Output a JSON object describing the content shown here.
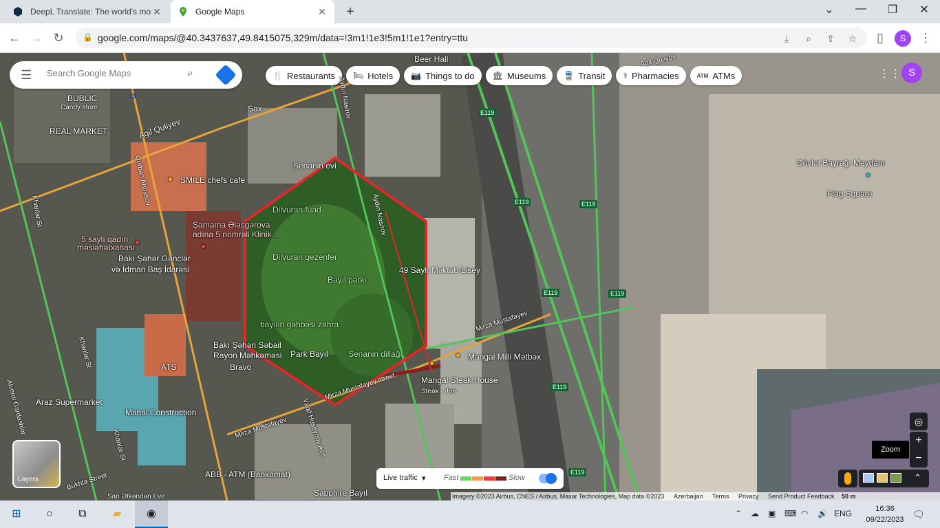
{
  "browser": {
    "tabs": [
      {
        "title": "DeepL Translate: The world's most",
        "active": false
      },
      {
        "title": "Google Maps",
        "active": true
      }
    ],
    "url": "google.com/maps/@40.3437637,49.8415075,329m/data=!3m1!1e3!5m1!1e1?entry=ttu",
    "profile_initial": "S"
  },
  "maps": {
    "search_placeholder": "Search Google Maps",
    "chips": [
      {
        "icon": "restaurant-icon",
        "glyph": "🍴",
        "label": "Restaurants"
      },
      {
        "icon": "hotel-icon",
        "glyph": "🛏",
        "label": "Hotels"
      },
      {
        "icon": "camera-icon",
        "glyph": "📷",
        "label": "Things to do"
      },
      {
        "icon": "museum-icon",
        "glyph": "🏛",
        "label": "Museums"
      },
      {
        "icon": "transit-icon",
        "glyph": "🚆",
        "label": "Transit"
      },
      {
        "icon": "pharmacy-icon",
        "glyph": "⚕",
        "label": "Pharmacies"
      },
      {
        "icon": "atm-icon",
        "glyph": "ATM",
        "label": "ATMs"
      }
    ],
    "profile_initial": "S",
    "place_labels": {
      "bublic": "BUBLIC",
      "candy_store": "Candy store",
      "real_market": "REAL MARKET",
      "agil_quliyev": "Agil Quliyev",
      "sax": "Şax",
      "smile_cafe": "SMILE chefs cafe",
      "shamama": "Şamama Ələsgərova",
      "adina": "adına 5 nömrəli Klinik...",
      "qadin": "5 saylı qadın",
      "maslahatxanasi": "məsləhətxanası",
      "baki_saher": "Bakı Şəhər Gənclər",
      "idman": "və İdman Baş İdarəsi",
      "senanin_evi": "Senanin evi",
      "dilvuran_fuad": "Dilvuran fuad",
      "dilvuran_qezenfer": "Dilvuran qezenfer",
      "bayil_parki": "Bayıl parkı",
      "bayilin_gehbesi": "bayılın gəhbəsi zəhra",
      "park_bayil": "Park Bayıl",
      "senanin_dillagi": "Senanin dillağı",
      "mekteb": "49 Saylı Məktəb-Lisey",
      "mangal_milli": "Mangal Milli Mətbəx",
      "mangal_steak": "Mangal Steak House",
      "steak": "Steak · ₼₼",
      "sebail_1": "Bakı Şəhəri Səbail",
      "sebail_2": "Rayon Məhkəməsi",
      "ats": "ATS",
      "bravo": "Bravo",
      "araz": "Araz Supermarket",
      "mahal": "Mahal Construction",
      "abb_atm": "ABB - ATM (Bankomat)",
      "sapphire": "Sapphire Bayıl",
      "san": "San Ətkəndən Eve",
      "beer_hall": "Beer Hall",
      "agil_quliyev_st": "Agil Quliyev",
      "devlet": "Dövlət Bayrağı Meydanı",
      "flag_square": "Flag Square",
      "aydin_nasirov": "Aydın Nasirov",
      "aydin_nasirov_2": "Aydın Nasirov",
      "mirza_1": "Mirza Mustafayev",
      "mirza_2": "Mirza Mustafayev street",
      "mirza_3": "Mirza Mustafayev",
      "qurban": "Qurban Abbasov",
      "khanlar": "Khanlar St",
      "khanlar_2": "Khanlar St",
      "khanlar_3": "Khanlar St",
      "alverdi": "Alverdi Gardashlar",
      "bukhta": "Bukhta Street",
      "huseynov": "Vaqif Huseynov Ave",
      "e119": "E119"
    },
    "layers_label": "Layers",
    "traffic": {
      "label": "Live traffic",
      "fast": "Fast",
      "slow": "Slow",
      "enabled": true,
      "colors": [
        "#63d668",
        "#ff974d",
        "#f23c32",
        "#811f1f"
      ]
    },
    "zoom_tooltip": "Zoom",
    "attribution": "Imagery ©2023 Airbus, CNES / Airbus, Maxar Technologies, Map data ©2023",
    "footer_links": [
      "Azerbaijan",
      "Terms",
      "Privacy",
      "Send Product Feedback"
    ],
    "scale": "50 m",
    "annotation_color": "#e3262a"
  },
  "taskbar": {
    "language": "ENG",
    "time": "16:36",
    "date": "09/22/2023"
  }
}
